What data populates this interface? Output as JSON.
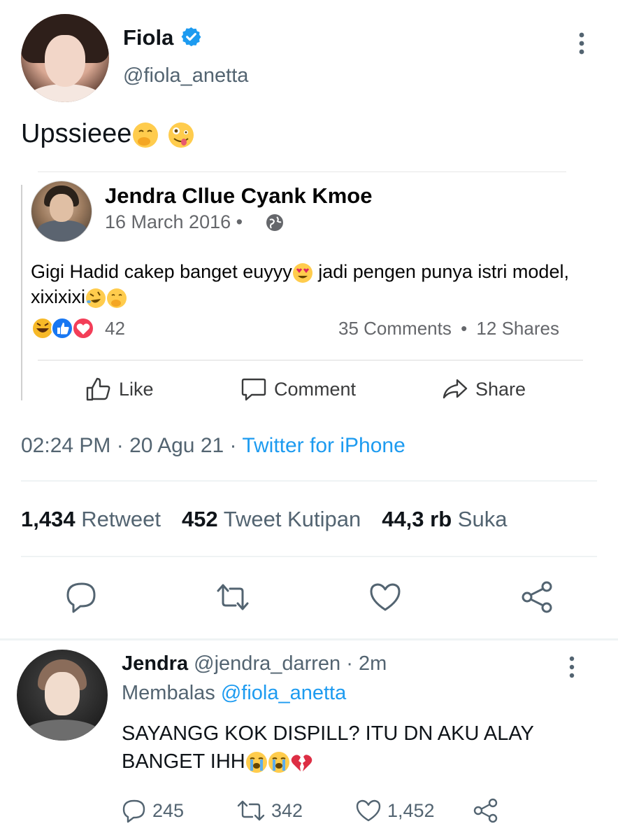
{
  "main_tweet": {
    "name": "Fiola",
    "handle": "@fiola_anetta",
    "text": "Upssieee",
    "text_emojis": [
      "face-with-hand-over-mouth",
      "zany-face"
    ]
  },
  "embedded_post": {
    "name": "Jendra Cllue Cyank Kmoe",
    "date": "16 March 2016 •",
    "text_part1": "Gigi Hadid cakep banget euyyy",
    "text_part2": " jadi pengen punya istri model, xixixixi",
    "reaction_count": "42",
    "comments": "35 Comments",
    "shares": "12 Shares",
    "stats_separator": "•",
    "actions": {
      "like": "Like",
      "comment": "Comment",
      "share": "Share"
    }
  },
  "timestamp": {
    "time": "02:24 PM · 20 Agu 21 · ",
    "source": "Twitter for iPhone"
  },
  "stats": {
    "retweets_count": "1,434",
    "retweets_label": "Retweet",
    "quotes_count": "452",
    "quotes_label": "Tweet Kutipan",
    "likes_count": "44,3 rb",
    "likes_label": "Suka"
  },
  "reply": {
    "name": "Jendra",
    "handle_time": "@jendra_darren · 2m",
    "replying_label": "Membalas",
    "replying_to": "@fiola_anetta",
    "text_line1": "SAYANGG KOK DISPILL? ITU DN AKU ALAY",
    "text_line2": "BANGET IHH",
    "replies": "245",
    "retweets": "342",
    "likes": "1,452"
  },
  "colors": {
    "accent": "#1d9bf0",
    "secondary_text": "#536471",
    "fb_secondary": "#65676b"
  }
}
